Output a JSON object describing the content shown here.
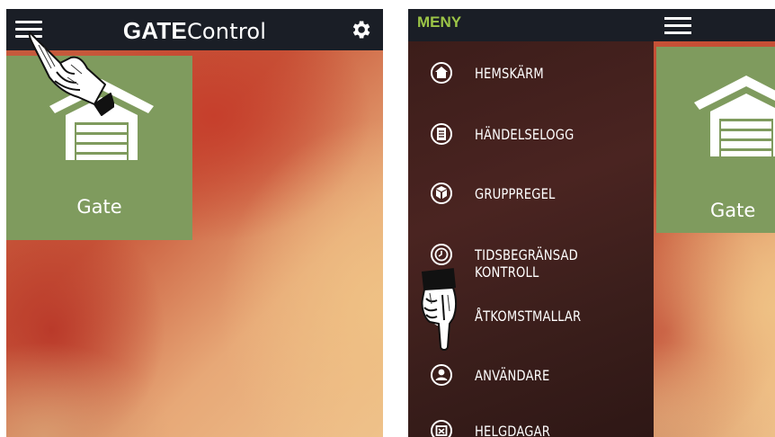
{
  "left_screen": {
    "app_title_bold": "GATE",
    "app_title_regular": "Control",
    "tile": {
      "label": "Gate",
      "color": "#7f9b5e"
    },
    "icons": [
      "hamburger-menu-icon",
      "gear-icon",
      "garage-icon",
      "pointing-hand-icon"
    ]
  },
  "right_screen": {
    "menu_header": "MENY",
    "menu_items": [
      {
        "label": "HEMSKÄRM",
        "icon": "home-icon"
      },
      {
        "label": "HÄNDELSELOGG",
        "icon": "document-icon"
      },
      {
        "label": "GRUPPREGEL",
        "icon": "boxes-icon"
      },
      {
        "label": "TIDSBEGRÄNSAD KONTROLL",
        "icon": "clock-icon"
      },
      {
        "label": "ÅTKOMSTMALLAR",
        "icon": "template-icon"
      },
      {
        "label": "ANVÄNDARE",
        "icon": "user-icon"
      },
      {
        "label": "HELGDAGAR",
        "icon": "calendar-icon"
      }
    ],
    "tile": {
      "label": "Gate"
    }
  },
  "colors": {
    "topbar": "#1a1e26",
    "accent_green": "#9cc547",
    "tile_green": "#7f9b5e"
  }
}
